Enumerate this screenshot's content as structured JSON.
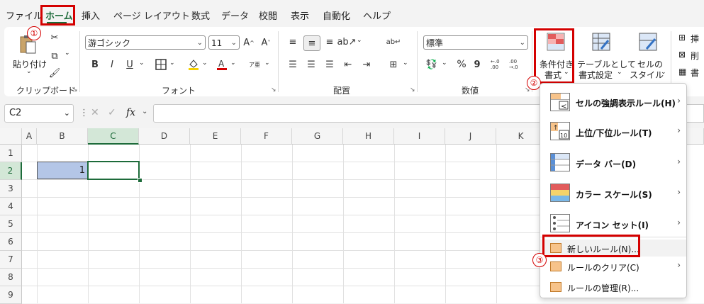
{
  "tabs": [
    "ファイル",
    "ホーム",
    "挿入",
    "ページ レイアウト",
    "数式",
    "データ",
    "校閲",
    "表示",
    "自動化",
    "ヘルプ"
  ],
  "ribbon": {
    "clipboard": {
      "paste_label_1": "貼り付け",
      "group_label": "クリップボード"
    },
    "font": {
      "font_name": "游ゴシック",
      "font_size": "11",
      "group_label": "フォント",
      "bold": "B",
      "italic": "I",
      "underline": "U",
      "grow": "A^",
      "shrink": "A˅",
      "phonetic": "ア亜"
    },
    "alignment": {
      "group_label": "配置"
    },
    "number": {
      "format": "標準",
      "group_label": "数値",
      "percent": "%",
      "comma": "9",
      "inc_dec": "←.0 .00",
      "dec_dec": ".00 →.0"
    },
    "styles": {
      "cond_format_line1": "条件付き",
      "cond_format_line2": "書式",
      "table_line1": "テーブルとして",
      "table_line2": "書式設定",
      "cell_style_line1": "セルの",
      "cell_style_line2": "スタイル"
    },
    "cells": {
      "insert": "挿",
      "delete": "削",
      "format": "書"
    }
  },
  "formula_bar": {
    "name_box": "C2",
    "fx": "fx",
    "value": ""
  },
  "sheet": {
    "columns": [
      "A",
      "B",
      "C",
      "D",
      "E",
      "F",
      "G",
      "H",
      "I",
      "J",
      "K"
    ],
    "rows": [
      "1",
      "2",
      "3",
      "4",
      "5",
      "6",
      "7",
      "8",
      "9"
    ],
    "cell_B2": "1",
    "selected_cell": "C2"
  },
  "menu": {
    "items": [
      {
        "label": "セルの強調表示ルール(H)"
      },
      {
        "label": "上位/下位ルール(T)"
      },
      {
        "label": "データ バー(D)"
      },
      {
        "label": "カラー スケール(S)"
      },
      {
        "label": "アイコン セット(I)"
      }
    ],
    "small_items": [
      {
        "label": "新しいルール(N)..."
      },
      {
        "label": "ルールのクリア(C)"
      },
      {
        "label": "ルールの管理(R)..."
      }
    ]
  },
  "annotations": [
    "①",
    "②",
    "③"
  ],
  "colors": {
    "accent": "#1d6b3a",
    "highlight": "#d40000",
    "selection_fill": "#b4c6e7"
  }
}
